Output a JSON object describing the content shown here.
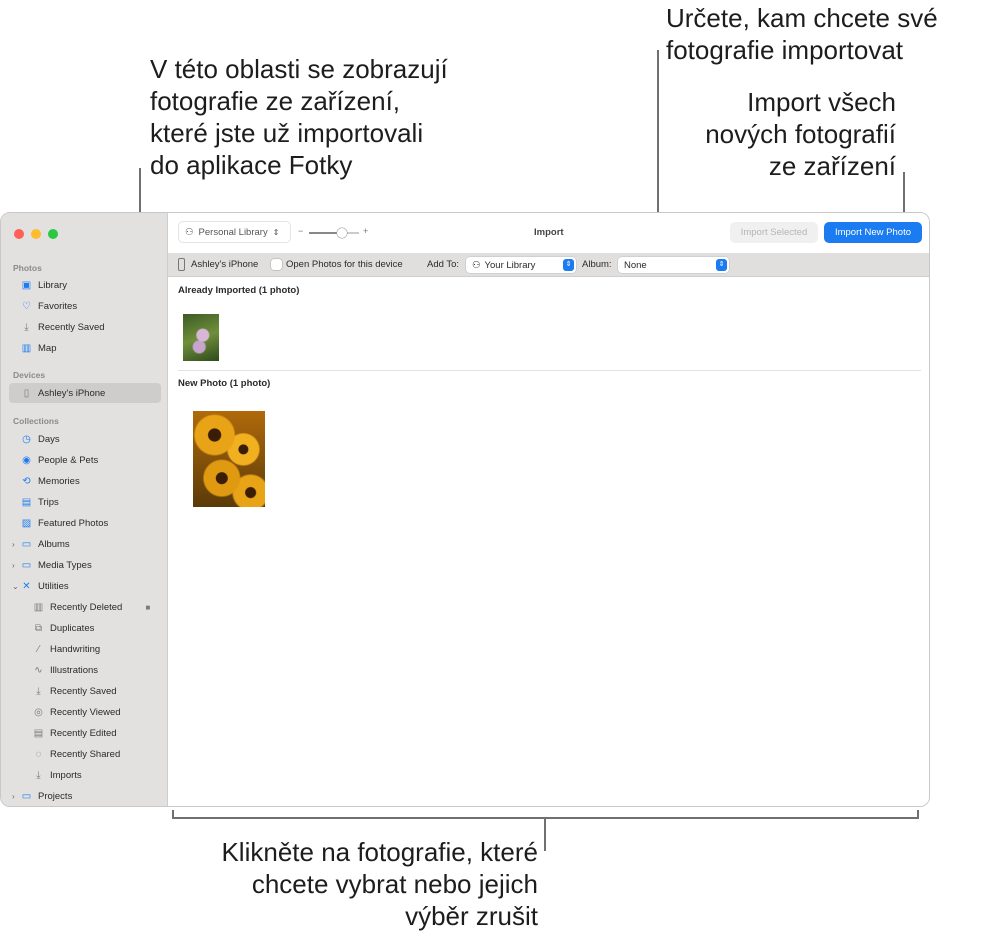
{
  "callouts": {
    "top_left": [
      "V této oblasti se zobrazují",
      "fotografie ze zařízení,",
      "které jste už importovali",
      "do aplikace Fotky"
    ],
    "top_right": [
      "Určete, kam chcete své",
      "fotografie importovat"
    ],
    "import_all": [
      "Import všech",
      "nových fotografií",
      "ze zařízení"
    ],
    "bottom": [
      "Klikněte na fotografie, které",
      "chcete vybrat nebo jejich",
      "výběr zrušit"
    ]
  },
  "toolbar": {
    "library": "Personal Library",
    "zoom_minus": "−",
    "zoom_plus": "+",
    "title": "Import",
    "import_selected": "Import Selected",
    "import_new": "Import New Photo"
  },
  "devbar": {
    "device": "Ashley's iPhone",
    "open_photos": "Open Photos for this device",
    "add_to_label": "Add To:",
    "add_to_value": "Your Library",
    "album_label": "Album:",
    "album_value": "None"
  },
  "content": {
    "already": "Already Imported (1 photo)",
    "new": "New Photo (1 photo)"
  },
  "sidebar": {
    "sections": {
      "photos": "Photos",
      "devices": "Devices",
      "collections": "Collections"
    },
    "photos": [
      "Library",
      "Favorites",
      "Recently Saved",
      "Map"
    ],
    "device": "Ashley's iPhone",
    "collections": [
      "Days",
      "People & Pets",
      "Memories",
      "Trips",
      "Featured Photos",
      "Albums",
      "Media Types",
      "Utilities"
    ],
    "utilities": [
      "Recently Deleted",
      "Duplicates",
      "Handwriting",
      "Illustrations",
      "Recently Saved",
      "Recently Viewed",
      "Recently Edited",
      "Recently Shared",
      "Imports"
    ],
    "projects": "Projects"
  },
  "colors": {
    "accent": "#1a7cf0"
  }
}
